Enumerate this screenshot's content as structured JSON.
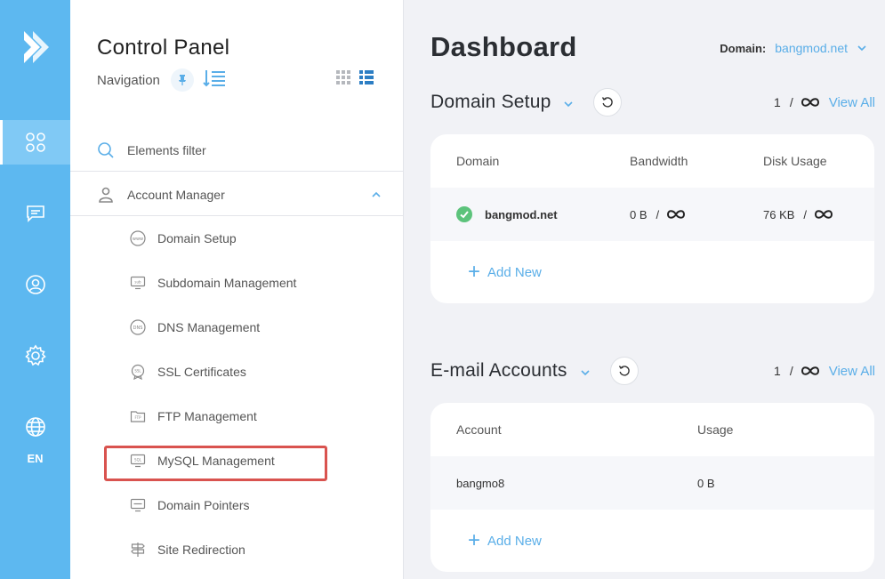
{
  "nav": {
    "title": "Control Panel",
    "subtitle": "Navigation",
    "filter_label": "Elements filter",
    "account_manager": "Account Manager",
    "items": [
      {
        "label": "Domain Setup"
      },
      {
        "label": "Subdomain Management"
      },
      {
        "label": "DNS Management"
      },
      {
        "label": "SSL Certificates"
      },
      {
        "label": "FTP Management"
      },
      {
        "label": "MySQL Management"
      },
      {
        "label": "Domain Pointers"
      },
      {
        "label": "Site Redirection"
      }
    ]
  },
  "rail": {
    "lang": "EN"
  },
  "main": {
    "title": "Dashboard",
    "domain_key": "Domain:",
    "domain_value": "bangmod.net",
    "domain_setup": {
      "title": "Domain Setup",
      "count": "1",
      "sep": "/",
      "view_all": "View All",
      "columns": [
        "Domain",
        "Bandwidth",
        "Disk Usage"
      ],
      "row": {
        "domain": "bangmod.net",
        "bandwidth": "0 B",
        "disk": "76 KB",
        "sep": "/"
      },
      "add_new": "Add New"
    },
    "email_accounts": {
      "title": "E-mail Accounts",
      "count": "1",
      "sep": "/",
      "view_all": "View All",
      "columns": [
        "Account",
        "Usage"
      ],
      "row": {
        "account": "bangmo8",
        "usage": "0 B"
      },
      "add_new": "Add New"
    }
  },
  "colors": {
    "rail": "#5db8f0",
    "accent": "#5aaee8",
    "highlight": "#d9534f",
    "success": "#5cc37b"
  }
}
